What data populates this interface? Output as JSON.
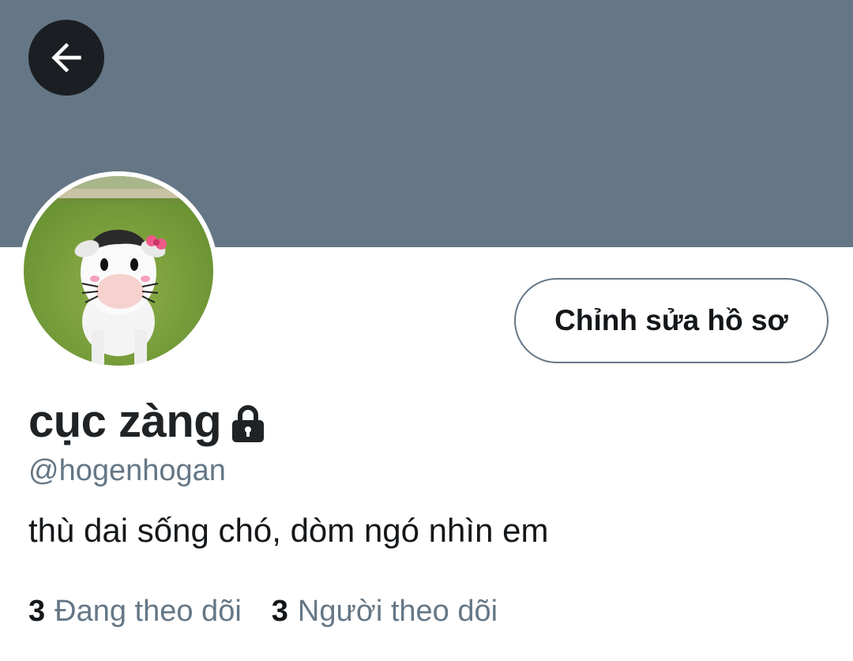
{
  "profile": {
    "banner_color": "#657786",
    "display_name": "cục zàng",
    "handle": "@hogenhogan",
    "bio": "thù dai sống chó, dòm ngó nhìn em",
    "protected_icon": "lock-icon",
    "avatar_description": "avatar-image"
  },
  "actions": {
    "back_icon": "arrow-left-icon",
    "edit_profile_label": "Chỉnh sửa hồ sơ"
  },
  "stats": {
    "following_count": "3",
    "following_label": "Đang theo dõi",
    "followers_count": "3",
    "followers_label": "Người theo dõi"
  },
  "colors": {
    "text_primary": "#14171a",
    "text_secondary": "#657786",
    "back_button_bg": "#1b1f23"
  }
}
